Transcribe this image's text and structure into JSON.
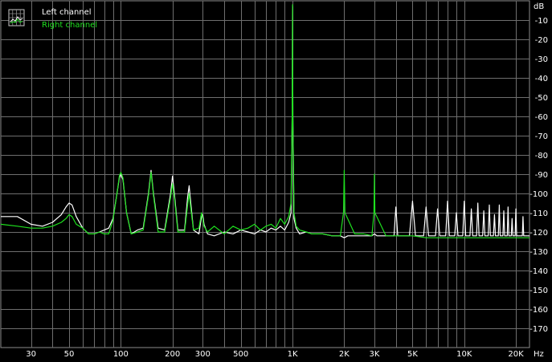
{
  "chart_data": {
    "type": "line",
    "xscale": "log",
    "xlim": [
      20,
      24000
    ],
    "ylim": [
      -180,
      0
    ],
    "grid": true,
    "legend_position": "top-left",
    "ylabel_unit": "dB",
    "xlabel_unit": "Hz",
    "x_ticks": [
      {
        "value": 30,
        "label": "30"
      },
      {
        "value": 50,
        "label": "50"
      },
      {
        "value": 100,
        "label": "100"
      },
      {
        "value": 200,
        "label": "200"
      },
      {
        "value": 300,
        "label": "300"
      },
      {
        "value": 500,
        "label": "500"
      },
      {
        "value": 1000,
        "label": "1K"
      },
      {
        "value": 2000,
        "label": "2K"
      },
      {
        "value": 3000,
        "label": "3K"
      },
      {
        "value": 5000,
        "label": "5K"
      },
      {
        "value": 10000,
        "label": "10K"
      },
      {
        "value": 20000,
        "label": "20K"
      }
    ],
    "y_ticks": [
      {
        "value": -10,
        "label": "-10"
      },
      {
        "value": -20,
        "label": "-20"
      },
      {
        "value": -30,
        "label": "-30"
      },
      {
        "value": -40,
        "label": "-40"
      },
      {
        "value": -50,
        "label": "-50"
      },
      {
        "value": -60,
        "label": "-60"
      },
      {
        "value": -70,
        "label": "-70"
      },
      {
        "value": -80,
        "label": "-80"
      },
      {
        "value": -90,
        "label": "-90"
      },
      {
        "value": -100,
        "label": "-100"
      },
      {
        "value": -110,
        "label": "-110"
      },
      {
        "value": -120,
        "label": "-120"
      },
      {
        "value": -130,
        "label": "-130"
      },
      {
        "value": -140,
        "label": "-140"
      },
      {
        "value": -150,
        "label": "-150"
      },
      {
        "value": -160,
        "label": "-160"
      },
      {
        "value": -170,
        "label": "-170"
      }
    ],
    "series": [
      {
        "name": "Left channel",
        "color": "#ffffff",
        "x": [
          20,
          25,
          30,
          35,
          40,
          45,
          48,
          50,
          52,
          55,
          60,
          65,
          70,
          75,
          80,
          85,
          90,
          95,
          98,
          100,
          103,
          108,
          115,
          125,
          135,
          145,
          150,
          155,
          165,
          180,
          195,
          200,
          205,
          215,
          235,
          245,
          250,
          255,
          265,
          285,
          295,
          300,
          305,
          320,
          350,
          400,
          450,
          500,
          550,
          600,
          650,
          700,
          750,
          800,
          850,
          900,
          950,
          980,
          995,
          1000,
          1005,
          1020,
          1050,
          1100,
          1200,
          1300,
          1500,
          1700,
          1900,
          2000,
          2100,
          2300,
          2600,
          2900,
          3000,
          3100,
          3500,
          3900,
          4000,
          4100,
          4800,
          5000,
          5200,
          5800,
          6000,
          6200,
          6800,
          7000,
          7200,
          7800,
          8000,
          8200,
          8800,
          9000,
          9200,
          9800,
          10000,
          10200,
          10800,
          11000,
          11200,
          11800,
          12000,
          12200,
          12800,
          13000,
          13200,
          13800,
          14000,
          14200,
          14800,
          15000,
          15200,
          15800,
          16000,
          16200,
          16800,
          17000,
          17200,
          17800,
          18000,
          18200,
          18800,
          19000,
          19200,
          19800,
          20000,
          20200,
          21800,
          22000,
          22200,
          24000
        ],
        "y": [
          -112,
          -112,
          -116,
          -117,
          -115,
          -111,
          -107,
          -105,
          -106,
          -112,
          -118,
          -121,
          -121,
          -120,
          -119,
          -118,
          -113,
          -100,
          -92,
          -90,
          -93,
          -110,
          -121,
          -119,
          -118,
          -100,
          -88,
          -100,
          -118,
          -119,
          -100,
          -91,
          -100,
          -119,
          -119,
          -102,
          -96,
          -104,
          -119,
          -121,
          -112,
          -111,
          -116,
          -121,
          -122,
          -120,
          -121,
          -119,
          -120,
          -121,
          -119,
          -120,
          -118,
          -119,
          -117,
          -119,
          -115,
          -110,
          -60,
          -3,
          -60,
          -113,
          -118,
          -121,
          -120,
          -121,
          -121,
          -122,
          -122,
          -123,
          -122,
          -122,
          -122,
          -122,
          -121,
          -122,
          -122,
          -122,
          -107,
          -122,
          -122,
          -104,
          -122,
          -122,
          -107,
          -122,
          -122,
          -108,
          -122,
          -122,
          -104,
          -122,
          -122,
          -110,
          -122,
          -122,
          -104,
          -122,
          -122,
          -108,
          -122,
          -122,
          -105,
          -122,
          -122,
          -109,
          -122,
          -122,
          -106,
          -122,
          -122,
          -111,
          -122,
          -122,
          -106,
          -122,
          -122,
          -109,
          -122,
          -122,
          -107,
          -122,
          -122,
          -113,
          -122,
          -122,
          -108,
          -122,
          -122,
          -112,
          -122,
          -122
        ]
      },
      {
        "name": "Right channel",
        "color": "#1ee01e",
        "x": [
          20,
          25,
          30,
          35,
          40,
          45,
          48,
          50,
          52,
          55,
          60,
          65,
          70,
          75,
          80,
          85,
          90,
          95,
          98,
          100,
          103,
          108,
          115,
          125,
          135,
          145,
          150,
          155,
          165,
          180,
          195,
          200,
          205,
          215,
          235,
          245,
          250,
          255,
          265,
          285,
          295,
          300,
          305,
          320,
          350,
          400,
          450,
          500,
          550,
          600,
          650,
          700,
          750,
          800,
          850,
          900,
          950,
          980,
          995,
          1000,
          1005,
          1020,
          1050,
          1100,
          1200,
          1300,
          1500,
          1700,
          1900,
          1980,
          2000,
          2020,
          2300,
          2600,
          2900,
          2980,
          3000,
          3020,
          3500,
          4000,
          5000,
          6000,
          7000,
          8000,
          10000,
          12000,
          15000,
          20000,
          24000
        ],
        "y": [
          -116,
          -117,
          -118,
          -118,
          -117,
          -115,
          -113,
          -111,
          -112,
          -116,
          -118,
          -121,
          -121,
          -120,
          -121,
          -121,
          -114,
          -100,
          -91,
          -89,
          -92,
          -110,
          -121,
          -120,
          -119,
          -101,
          -89,
          -101,
          -120,
          -120,
          -102,
          -95,
          -102,
          -120,
          -120,
          -106,
          -100,
          -107,
          -119,
          -118,
          -110,
          -113,
          -117,
          -120,
          -117,
          -121,
          -117,
          -119,
          -118,
          -116,
          -119,
          -117,
          -116,
          -118,
          -113,
          -116,
          -112,
          -105,
          -60,
          -2,
          -60,
          -110,
          -117,
          -119,
          -120,
          -121,
          -121,
          -122,
          -122,
          -110,
          -88,
          -110,
          -121,
          -121,
          -122,
          -110,
          -90,
          -110,
          -122,
          -122,
          -122,
          -123,
          -123,
          -123,
          -123,
          -123,
          -123,
          -123,
          -123
        ]
      }
    ]
  }
}
